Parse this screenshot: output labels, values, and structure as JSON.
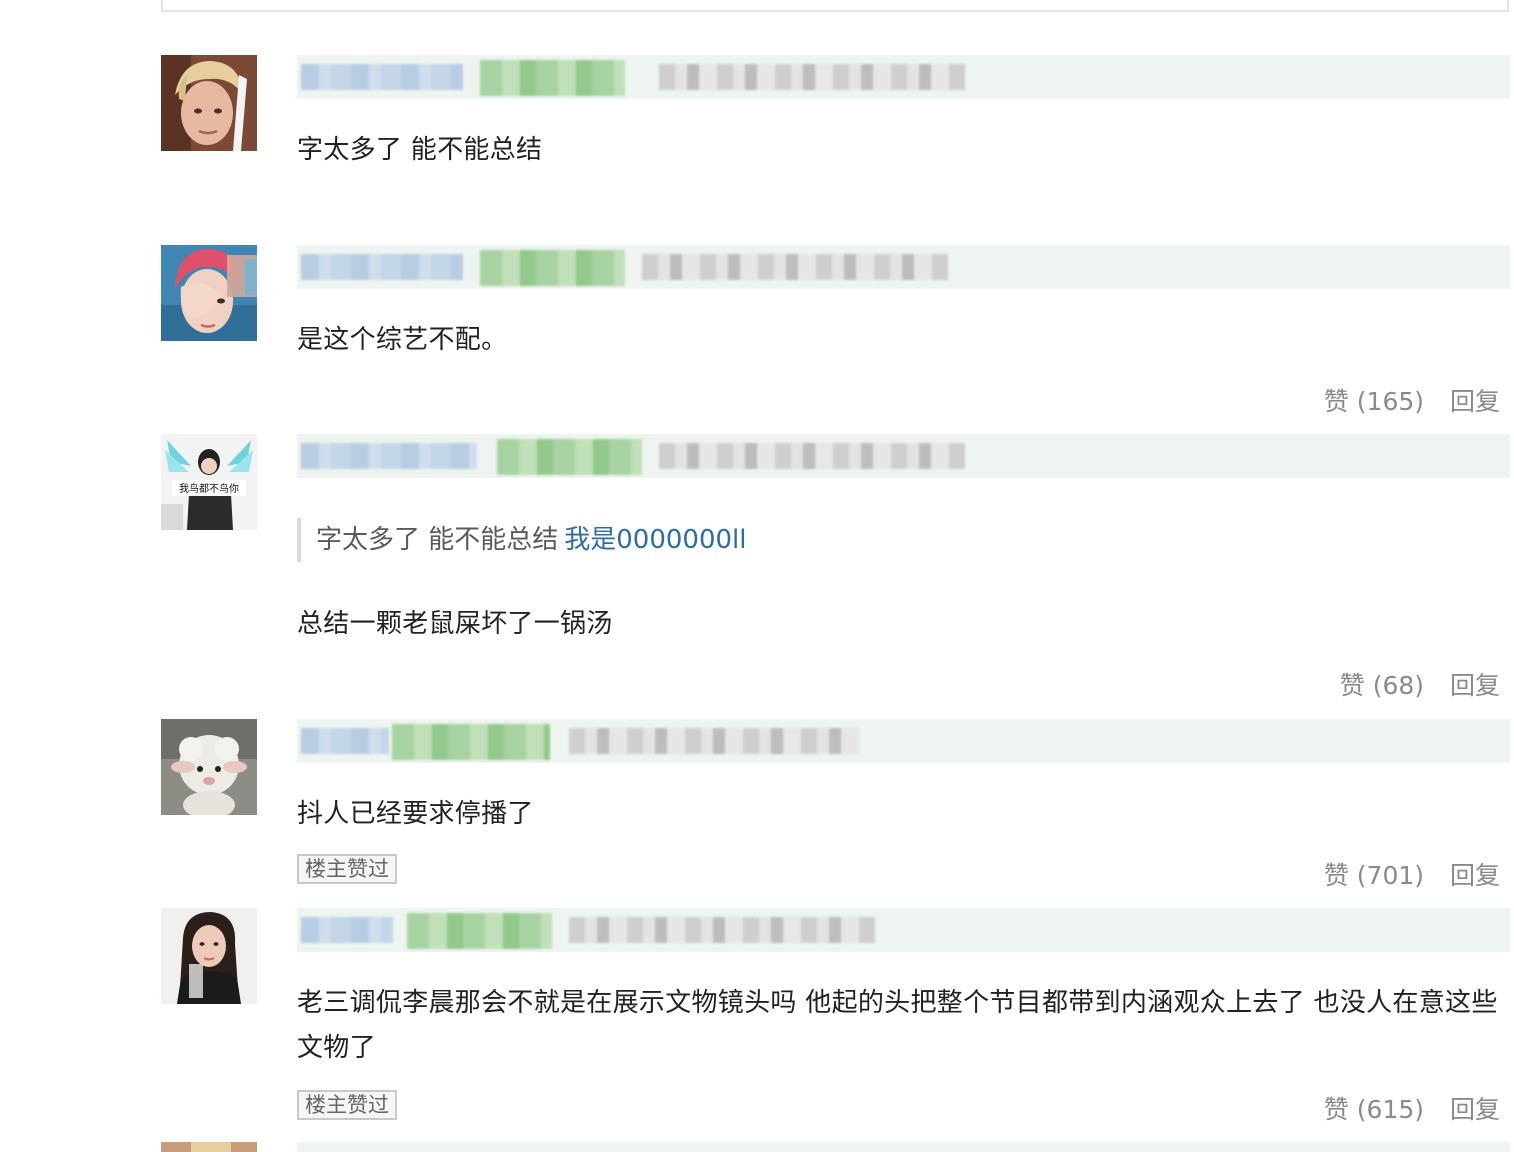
{
  "comments": [
    {
      "text": "字太多了 能不能总结",
      "like_label": "",
      "reply_label": ""
    },
    {
      "text": "是这个综艺不配。",
      "like_label": "赞 (165)",
      "reply_label": "回复"
    },
    {
      "quote_text": "字太多了 能不能总结",
      "quote_author": "我是0000000ll",
      "text": "总结一颗老鼠屎坏了一锅汤",
      "like_label": "赞 (68)",
      "reply_label": "回复"
    },
    {
      "text": "抖人已经要求停播了",
      "op_badge": "楼主赞过",
      "like_label": "赞 (701)",
      "reply_label": "回复"
    },
    {
      "text": "老三调侃李晨那会不就是在展示文物镜头吗 他起的头把整个节目都带到内涵观众上去了 也没人在意这些文物了",
      "op_badge": "楼主赞过",
      "like_label": "赞 (615)",
      "reply_label": "回复"
    }
  ],
  "avatar3_caption": "我鸟都不鸟你",
  "icons": [
    "avatar-blond-boy",
    "avatar-red-hair",
    "avatar-wings-meme",
    "avatar-lamb",
    "avatar-woman"
  ]
}
